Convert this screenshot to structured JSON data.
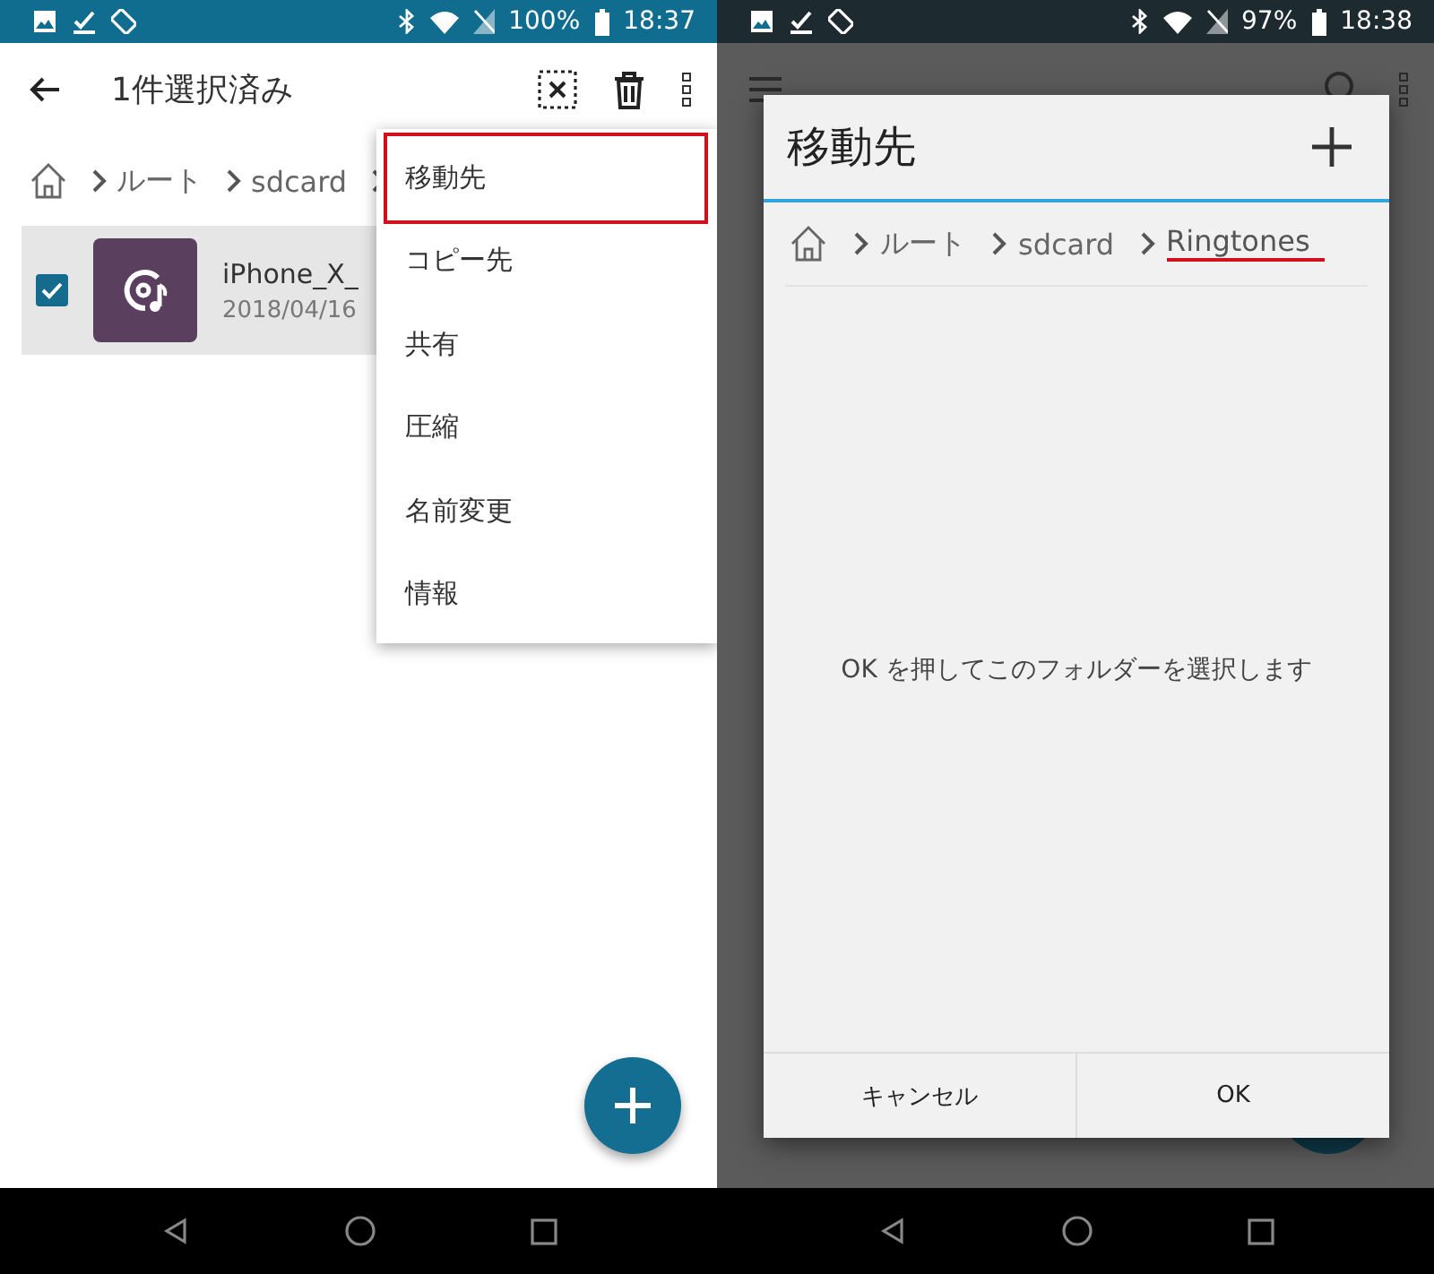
{
  "screens": [
    {
      "status_bar": {
        "battery": "100%",
        "time": "18:37"
      },
      "toolbar": {
        "title": "1件選択済み"
      },
      "breadcrumb": [
        {
          "label": "ルート",
          "underlined": false
        },
        {
          "label": "sdcard",
          "underlined": false
        }
      ],
      "files": [
        {
          "name": "iPhone_X_",
          "date": "2018/04/16",
          "checked": true
        }
      ],
      "menu": [
        {
          "label": "移動先",
          "highlighted": true
        },
        {
          "label": "コピー先",
          "highlighted": false
        },
        {
          "label": "共有",
          "highlighted": false
        },
        {
          "label": "圧縮",
          "highlighted": false
        },
        {
          "label": "名前変更",
          "highlighted": false
        },
        {
          "label": "情報",
          "highlighted": false
        }
      ]
    },
    {
      "status_bar": {
        "battery": "97%",
        "time": "18:38"
      },
      "dialog": {
        "title": "移動先",
        "breadcrumb": [
          {
            "label": "ルート",
            "underlined": false
          },
          {
            "label": "sdcard",
            "underlined": false
          },
          {
            "label": "Ringtones",
            "underlined": true
          }
        ],
        "message": "OK を押してこのフォルダーを選択します",
        "buttons": [
          "キャンセル",
          "OK"
        ]
      }
    }
  ]
}
